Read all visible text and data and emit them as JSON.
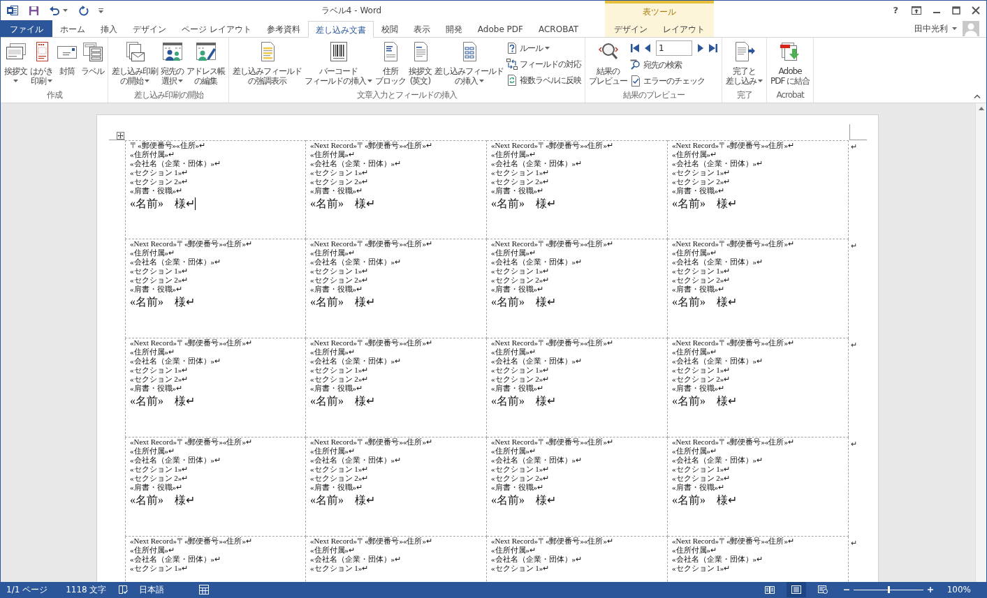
{
  "title_bar": {
    "title": "ラベル4 - Word",
    "help": "?"
  },
  "tabs": [
    {
      "kind": "file",
      "label": "ファイル",
      "selected": false
    },
    {
      "kind": "tab",
      "label": "ホーム",
      "selected": false
    },
    {
      "kind": "tab",
      "label": "挿入",
      "selected": false
    },
    {
      "kind": "tab",
      "label": "デザイン",
      "selected": false
    },
    {
      "kind": "tab",
      "label": "ページ レイアウト",
      "selected": false
    },
    {
      "kind": "tab",
      "label": "参考資料",
      "selected": false
    },
    {
      "kind": "tab",
      "label": "差し込み文書",
      "selected": true
    },
    {
      "kind": "tab",
      "label": "校閲",
      "selected": false
    },
    {
      "kind": "tab",
      "label": "表示",
      "selected": false
    },
    {
      "kind": "tab",
      "label": "開発",
      "selected": false
    },
    {
      "kind": "tab",
      "label": "Adobe PDF",
      "selected": false
    },
    {
      "kind": "tab",
      "label": "ACROBAT",
      "selected": false
    }
  ],
  "context_tabs": {
    "label": "表ツール",
    "tabs": [
      {
        "label": "デザイン",
        "selected": false
      },
      {
        "label": "レイアウト",
        "selected": false
      }
    ]
  },
  "user": {
    "name": "田中光利"
  },
  "ribbon": {
    "groups": [
      {
        "label": "作成",
        "items": [
          {
            "kind": "large",
            "lines": [
              "挨拶文"
            ],
            "dropdown": true
          },
          {
            "kind": "large",
            "lines": [
              "はがき",
              "印刷"
            ],
            "dropdown": true
          },
          {
            "kind": "large",
            "lines": [
              "封筒"
            ],
            "dropdown": false
          },
          {
            "kind": "large",
            "lines": [
              "ラベル"
            ],
            "dropdown": false
          }
        ]
      },
      {
        "label": "差し込み印刷の開始",
        "items": [
          {
            "kind": "large",
            "lines": [
              "差し込み印刷",
              "の開始"
            ],
            "dropdown": true
          },
          {
            "kind": "large",
            "lines": [
              "宛先の",
              "選択"
            ],
            "dropdown": true
          },
          {
            "kind": "large",
            "lines": [
              "アドレス帳",
              "の編集"
            ],
            "dropdown": false
          }
        ]
      },
      {
        "label": "文章入力とフィールドの挿入",
        "items": [
          {
            "kind": "large",
            "lines": [
              "差し込みフィールド",
              "の強調表示"
            ],
            "dropdown": false
          },
          {
            "kind": "large",
            "lines": [
              "バーコード",
              "フィールドの挿入"
            ],
            "dropdown": true
          },
          {
            "kind": "large",
            "lines": [
              "住所",
              "ブロック"
            ],
            "dropdown": false
          },
          {
            "kind": "large",
            "lines": [
              "挨拶文",
              "(英文)"
            ],
            "dropdown": false
          },
          {
            "kind": "large",
            "lines": [
              "差し込みフィールド",
              "の挿入"
            ],
            "dropdown": true
          },
          {
            "kind": "stack",
            "items": [
              {
                "kind": "small",
                "label": "ルール",
                "dropdown": true
              },
              {
                "kind": "small",
                "label": "フィールドの対応",
                "dropdown": false
              },
              {
                "kind": "small",
                "label": "複数ラベルに反映",
                "dropdown": false
              }
            ]
          }
        ]
      },
      {
        "label": "結果のプレビュー",
        "items": [
          {
            "kind": "large",
            "lines": [
              "結果の",
              "プレビュー"
            ],
            "dropdown": false
          },
          {
            "kind": "stack",
            "items": [
              {
                "kind": "nav",
                "record": "1"
              },
              {
                "kind": "small",
                "label": "宛先の検索",
                "dropdown": false
              },
              {
                "kind": "small",
                "label": "エラーのチェック",
                "dropdown": false
              }
            ]
          }
        ]
      },
      {
        "label": "完了",
        "items": [
          {
            "kind": "large",
            "lines": [
              "完了と",
              "差し込み"
            ],
            "dropdown": true
          }
        ]
      },
      {
        "label": "Acrobat",
        "items": [
          {
            "kind": "large",
            "lines": [
              "Adobe",
              "PDF に結合"
            ],
            "dropdown": false
          }
        ]
      }
    ]
  },
  "document": {
    "rows": [
      {
        "end_mark": "↵",
        "cells": [
          {
            "lines": [
              "〒«郵便番号»«住所»↵",
              "«住所付属»↵",
              "«会社名（企業・団体）»↵",
              "«セクション 1»↵",
              "«セクション 2»↵",
              "«肩書・役職»↵"
            ],
            "name": "«名前»　様↵",
            "cursor": true
          },
          {
            "lines": [
              "«Next Record»〒«郵便番号»«住所»↵",
              "«住所付属»↵",
              "«会社名（企業・団体）»↵",
              "«セクション 1»↵",
              "«セクション 2»↵",
              "«肩書・役職»↵"
            ],
            "name": "«名前»　様↵",
            "cursor": false
          },
          {
            "lines": [
              "«Next Record»〒«郵便番号»«住所»↵",
              "«住所付属»↵",
              "«会社名（企業・団体）»↵",
              "«セクション 1»↵",
              "«セクション 2»↵",
              "«肩書・役職»↵"
            ],
            "name": "«名前»　様↵",
            "cursor": false
          },
          {
            "lines": [
              "«Next Record»〒«郵便番号»«住所»↵",
              "«住所付属»↵",
              "«会社名（企業・団体）»↵",
              "«セクション 1»↵",
              "«セクション 2»↵",
              "«肩書・役職»↵"
            ],
            "name": "«名前»　様↵",
            "cursor": false
          }
        ]
      },
      {
        "end_mark": "↵",
        "cells": [
          {
            "lines": [
              "«Next Record»〒«郵便番号»«住所»↵",
              "«住所付属»↵",
              "«会社名（企業・団体）»↵",
              "«セクション 1»↵",
              "«セクション 2»↵",
              "«肩書・役職»↵"
            ],
            "name": "«名前»　様↵",
            "cursor": false
          },
          {
            "lines": [
              "«Next Record»〒«郵便番号»«住所»↵",
              "«住所付属»↵",
              "«会社名（企業・団体）»↵",
              "«セクション 1»↵",
              "«セクション 2»↵",
              "«肩書・役職»↵"
            ],
            "name": "«名前»　様↵",
            "cursor": false
          },
          {
            "lines": [
              "«Next Record»〒«郵便番号»«住所»↵",
              "«住所付属»↵",
              "«会社名（企業・団体）»↵",
              "«セクション 1»↵",
              "«セクション 2»↵",
              "«肩書・役職»↵"
            ],
            "name": "«名前»　様↵",
            "cursor": false
          },
          {
            "lines": [
              "«Next Record»〒«郵便番号»«住所»↵",
              "«住所付属»↵",
              "«会社名（企業・団体）»↵",
              "«セクション 1»↵",
              "«セクション 2»↵",
              "«肩書・役職»↵"
            ],
            "name": "«名前»　様↵",
            "cursor": false
          }
        ]
      },
      {
        "end_mark": "↵",
        "cells": [
          {
            "lines": [
              "«Next Record»〒«郵便番号»«住所»↵",
              "«住所付属»↵",
              "«会社名（企業・団体）»↵",
              "«セクション 1»↵",
              "«セクション 2»↵",
              "«肩書・役職»↵"
            ],
            "name": "«名前»　様↵",
            "cursor": false
          },
          {
            "lines": [
              "«Next Record»〒«郵便番号»«住所»↵",
              "«住所付属»↵",
              "«会社名（企業・団体）»↵",
              "«セクション 1»↵",
              "«セクション 2»↵",
              "«肩書・役職»↵"
            ],
            "name": "«名前»　様↵",
            "cursor": false
          },
          {
            "lines": [
              "«Next Record»〒«郵便番号»«住所»↵",
              "«住所付属»↵",
              "«会社名（企業・団体）»↵",
              "«セクション 1»↵",
              "«セクション 2»↵",
              "«肩書・役職»↵"
            ],
            "name": "«名前»　様↵",
            "cursor": false
          },
          {
            "lines": [
              "«Next Record»〒«郵便番号»«住所»↵",
              "«住所付属»↵",
              "«会社名（企業・団体）»↵",
              "«セクション 1»↵",
              "«セクション 2»↵",
              "«肩書・役職»↵"
            ],
            "name": "«名前»　様↵",
            "cursor": false
          }
        ]
      },
      {
        "end_mark": "↵",
        "cells": [
          {
            "lines": [
              "«Next Record»〒«郵便番号»«住所»↵",
              "«住所付属»↵",
              "«会社名（企業・団体）»↵",
              "«セクション 1»↵",
              "«セクション 2»↵",
              "«肩書・役職»↵"
            ],
            "name": "«名前»　様↵",
            "cursor": false
          },
          {
            "lines": [
              "«Next Record»〒«郵便番号»«住所»↵",
              "«住所付属»↵",
              "«会社名（企業・団体）»↵",
              "«セクション 1»↵",
              "«セクション 2»↵",
              "«肩書・役職»↵"
            ],
            "name": "«名前»　様↵",
            "cursor": false
          },
          {
            "lines": [
              "«Next Record»〒«郵便番号»«住所»↵",
              "«住所付属»↵",
              "«会社名（企業・団体）»↵",
              "«セクション 1»↵",
              "«セクション 2»↵",
              "«肩書・役職»↵"
            ],
            "name": "«名前»　様↵",
            "cursor": false
          },
          {
            "lines": [
              "«Next Record»〒«郵便番号»«住所»↵",
              "«住所付属»↵",
              "«会社名（企業・団体）»↵",
              "«セクション 1»↵",
              "«セクション 2»↵",
              "«肩書・役職»↵"
            ],
            "name": "«名前»　様↵",
            "cursor": false
          }
        ]
      },
      {
        "end_mark": "↵",
        "cells": [
          {
            "lines": [
              "«Next Record»〒«郵便番号»«住所»↵",
              "«住所付属»↵",
              "«会社名（企業・団体）»↵",
              "«セクション 1»↵"
            ],
            "cursor": false
          },
          {
            "lines": [
              "«Next Record»〒«郵便番号»«住所»↵",
              "«住所付属»↵",
              "«会社名（企業・団体）»↵",
              "«セクション 1»↵"
            ],
            "cursor": false
          },
          {
            "lines": [
              "«Next Record»〒«郵便番号»«住所»↵",
              "«住所付属»↵",
              "«会社名（企業・団体）»↵",
              "«セクション 1»↵"
            ],
            "cursor": false
          },
          {
            "lines": [
              "«Next Record»〒«郵便番号»«住所»↵",
              "«住所付属»↵",
              "«会社名（企業・団体）»↵",
              "«セクション 1»↵"
            ],
            "cursor": false
          }
        ]
      }
    ]
  },
  "status_bar": {
    "page": "1/1 ページ",
    "words": "1118 文字",
    "language": "日本語",
    "views": [
      {
        "selected": false
      },
      {
        "selected": true
      },
      {
        "selected": false
      }
    ],
    "zoom": {
      "level": 0.5,
      "reading": "100%"
    }
  }
}
